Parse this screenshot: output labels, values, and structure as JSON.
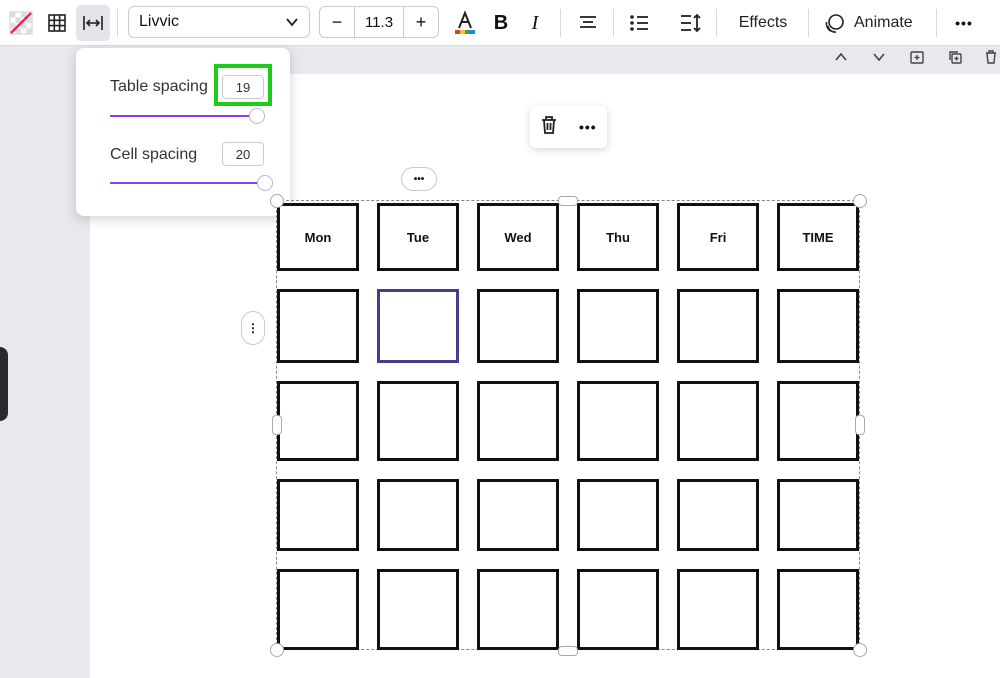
{
  "toolbar": {
    "font_name": "Livvic",
    "font_size": "11.3",
    "minus": "−",
    "plus": "+",
    "bold": "B",
    "italic": "I",
    "effects": "Effects",
    "animate": "Animate",
    "more": "•••"
  },
  "popover": {
    "table_spacing_label": "Table spacing",
    "table_spacing_value": "19",
    "table_spacing_fraction": 0.95,
    "cell_spacing_label": "Cell spacing",
    "cell_spacing_value": "20",
    "cell_spacing_fraction": 1.0
  },
  "float_menu": {
    "more": "•••"
  },
  "table": {
    "headers": [
      "Mon",
      "Tue",
      "Wed",
      "Thu",
      "Fri",
      "TIME"
    ],
    "rows": 4,
    "selected_cell": "row 1, column 2"
  },
  "colors": {
    "accent": "#8b3dff",
    "highlight": "#1ccd1c"
  }
}
